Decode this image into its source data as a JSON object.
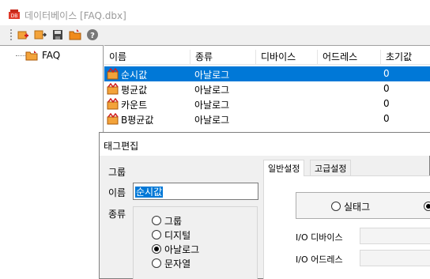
{
  "window": {
    "title": "데이터베이스 [FAQ.dbx]"
  },
  "toolbar": {
    "icons": [
      "add-tag-icon",
      "add-item-icon",
      "save-icon",
      "open-folder-icon",
      "help-icon"
    ]
  },
  "tree": {
    "items": [
      {
        "label": "FAQ",
        "icon": "folder-icon"
      }
    ]
  },
  "list": {
    "columns": [
      "이름",
      "종류",
      "디바이스",
      "어드레스",
      "초기값"
    ],
    "rows": [
      {
        "name": "순시값",
        "type": "아날로그",
        "device": "",
        "address": "",
        "initial": "0",
        "selected": true
      },
      {
        "name": "평균값",
        "type": "아날로그",
        "device": "",
        "address": "",
        "initial": "0",
        "selected": false
      },
      {
        "name": "카운트",
        "type": "아날로그",
        "device": "",
        "address": "",
        "initial": "0",
        "selected": false
      },
      {
        "name": "B평균값",
        "type": "아날로그",
        "device": "",
        "address": "",
        "initial": "0",
        "selected": false
      }
    ]
  },
  "dialog": {
    "title": "태그편집",
    "group_label": "그룹",
    "name_label": "이름",
    "name_value": "순시값",
    "type_label": "종류",
    "type_options": [
      {
        "label": "그룹",
        "checked": false
      },
      {
        "label": "디지털",
        "checked": false
      },
      {
        "label": "아날로그",
        "checked": true
      },
      {
        "label": "문자열",
        "checked": false
      }
    ],
    "tabs": [
      {
        "label": "일반설정",
        "active": true
      },
      {
        "label": "고급설정",
        "active": false
      }
    ],
    "mode_options": [
      {
        "label": "실태그",
        "checked": false
      },
      {
        "label": "",
        "checked": true
      }
    ],
    "io_device_label": "I/O 디바이스",
    "io_address_label": "I/O 어드레스"
  },
  "colors": {
    "selection": "#0078d7",
    "title_text": "#9a9a9a"
  }
}
